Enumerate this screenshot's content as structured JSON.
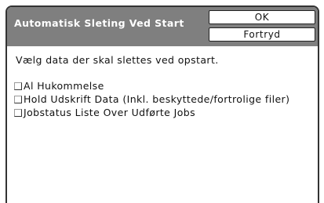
{
  "dialog": {
    "title": "Automatisk Sleting Ved Start",
    "ok_label": "OK",
    "cancel_label": "Fortryd",
    "instruction": "Vælg data der skal slettes ved opstart."
  },
  "options": [
    {
      "label": "Al Hukommelse",
      "checked": false
    },
    {
      "label": "Hold Udskrift Data (Inkl. beskyttede/fortrolige filer)",
      "checked": false
    },
    {
      "label": "Jobstatus Liste Over Udførte Jobs",
      "checked": false
    }
  ],
  "colors": {
    "title_bar": "#7f7f7f",
    "frame": "#333333"
  }
}
